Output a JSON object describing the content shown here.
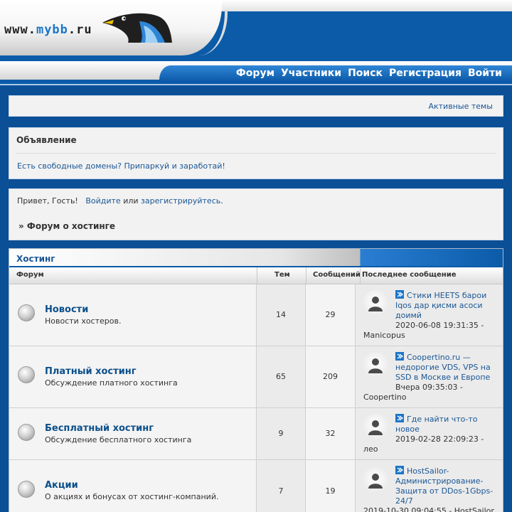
{
  "header": {
    "logo_prefix": "www.",
    "logo_brand": "mybb",
    "logo_suffix": ".ru",
    "nav": [
      "Форум",
      "Участники",
      "Поиск",
      "Регистрация",
      "Войти"
    ]
  },
  "active_topics": {
    "label": "Активные темы"
  },
  "announcement": {
    "title": "Объявление",
    "text": "Есть свободные домены? Припаркуй и заработай!"
  },
  "welcome": {
    "greeting": "Привет, Гость!",
    "login": "Войдите",
    "or": " или ",
    "register": "зарегистрируйтесь",
    "period": "."
  },
  "breadcrumb": "» Форум о хостинге",
  "category": {
    "title": "Хостинг",
    "columns": {
      "forum": "Форум",
      "topics": "Тем",
      "posts": "Сообщений",
      "last": "Последнее сообщение"
    },
    "forums": [
      {
        "title": "Новости",
        "desc": "Новости хостеров.",
        "topics": "14",
        "posts": "29",
        "last_title": "Стики HEETS барои Iqos дар қисми асоси доимй",
        "last_date": "2020-06-08 19:31:35 -",
        "last_author": "Manicopus"
      },
      {
        "title": "Платный хостинг",
        "desc": "Обсуждение платного хостинга",
        "topics": "65",
        "posts": "209",
        "last_title": "Coopertino.ru — недорогие VDS, VPS на SSD в Москве и Европе",
        "last_date": "Вчера 09:35:03 -",
        "last_author": "Coopertino"
      },
      {
        "title": "Бесплатный хостинг",
        "desc": "Обсуждение бесплатного хостинга",
        "topics": "9",
        "posts": "32",
        "last_title": "Где найти что-то новое",
        "last_date": "2019-02-28 22:09:23 -",
        "last_author": "лео"
      },
      {
        "title": "Акции",
        "desc": "О акциях и бонусах от хостинг-компаний.",
        "topics": "7",
        "posts": "19",
        "last_title": "HostSailor- Администрирование- Защита от DDos-1Gbps- 24/7",
        "last_date": "",
        "last_author": "2019-10-30 09:04:55 - HostSailor"
      }
    ]
  },
  "colors": {
    "accent": "#0b5ba9",
    "link": "#1b5795",
    "background": "#0b4f97"
  }
}
